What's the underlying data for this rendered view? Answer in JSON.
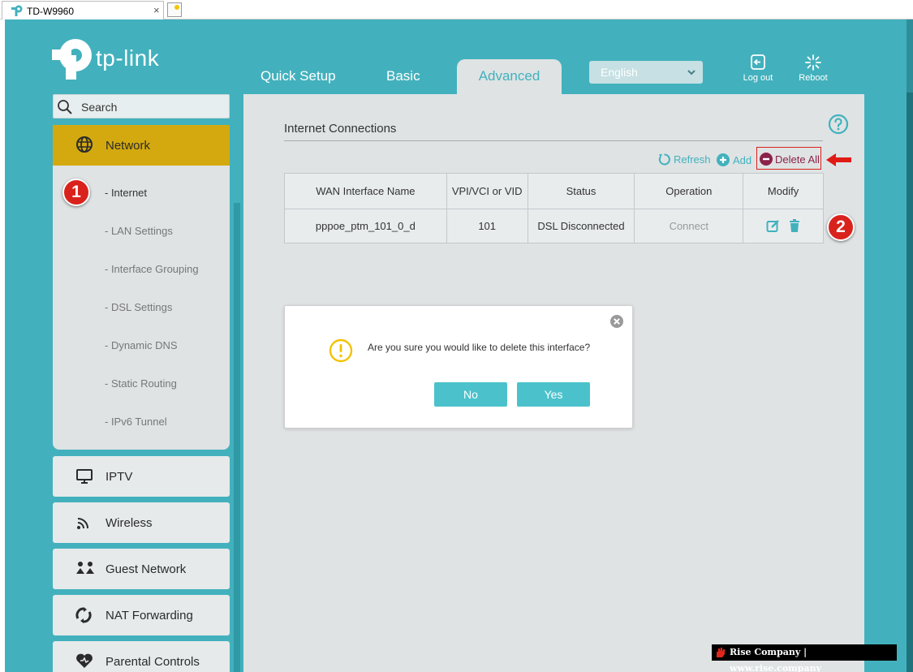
{
  "browser": {
    "tab_title": "TD-W9960",
    "tab_close": "×"
  },
  "header": {
    "logo_text": "tp-link",
    "tabs": [
      {
        "label": "Quick Setup"
      },
      {
        "label": "Basic"
      },
      {
        "label": "Advanced",
        "active": true
      }
    ],
    "language": "English",
    "logout_label": "Log out",
    "reboot_label": "Reboot"
  },
  "sidebar": {
    "search_placeholder": "Search",
    "network": {
      "label": "Network",
      "sub_items": [
        {
          "label": "- Internet",
          "active": true
        },
        {
          "label": "- LAN Settings"
        },
        {
          "label": "- Interface Grouping"
        },
        {
          "label": "- DSL Settings"
        },
        {
          "label": "- Dynamic DNS"
        },
        {
          "label": "- Static Routing"
        },
        {
          "label": "- IPv6 Tunnel"
        }
      ]
    },
    "items": [
      {
        "label": "IPTV",
        "icon": "monitor-icon"
      },
      {
        "label": "Wireless",
        "icon": "wifi-icon"
      },
      {
        "label": "Guest Network",
        "icon": "guest-icon"
      },
      {
        "label": "NAT Forwarding",
        "icon": "nat-icon"
      },
      {
        "label": "Parental Controls",
        "icon": "heart-icon"
      }
    ]
  },
  "annotations": {
    "badge_1": "1",
    "badge_2": "2"
  },
  "main": {
    "section_title": "Internet Connections",
    "toolbar": {
      "refresh_label": "Refresh",
      "add_label": "Add",
      "delete_all_label": "Delete All"
    },
    "table": {
      "headers": [
        "WAN Interface Name",
        "VPI/VCI or VID",
        "Status",
        "Operation",
        "Modify"
      ],
      "rows": [
        {
          "name": "pppoe_ptm_101_0_d",
          "vid": "101",
          "status": "DSL Disconnected",
          "operation": "Connect"
        }
      ]
    }
  },
  "dialog": {
    "message": "Are you sure you would like to delete this interface?",
    "no_label": "No",
    "yes_label": "Yes"
  },
  "watermark": {
    "text": "Rise Company | www.rise.company"
  },
  "colors": {
    "brand_teal": "#42b1bd",
    "accent_gold": "#d3a90f",
    "alert_red": "#d9221c"
  }
}
